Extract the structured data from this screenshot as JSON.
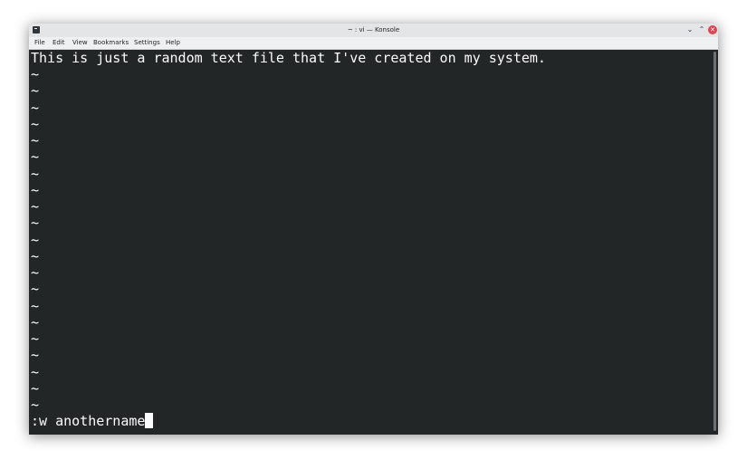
{
  "window": {
    "title": "~ : vi — Konsole",
    "minimize_glyph": "⌄",
    "maximize_glyph": "⌃",
    "close_glyph": "✕"
  },
  "menu": {
    "items": [
      "File",
      "Edit",
      "View",
      "Bookmarks",
      "Settings",
      "Help"
    ]
  },
  "terminal": {
    "first_line": "This is just a random text file that I've created on my system.",
    "tilde": "~",
    "tilde_count": 21,
    "command_line": ":w anothername"
  },
  "colors": {
    "terminal_bg": "#232627",
    "terminal_fg": "#fcfcfc",
    "close_button": "#da4453"
  }
}
